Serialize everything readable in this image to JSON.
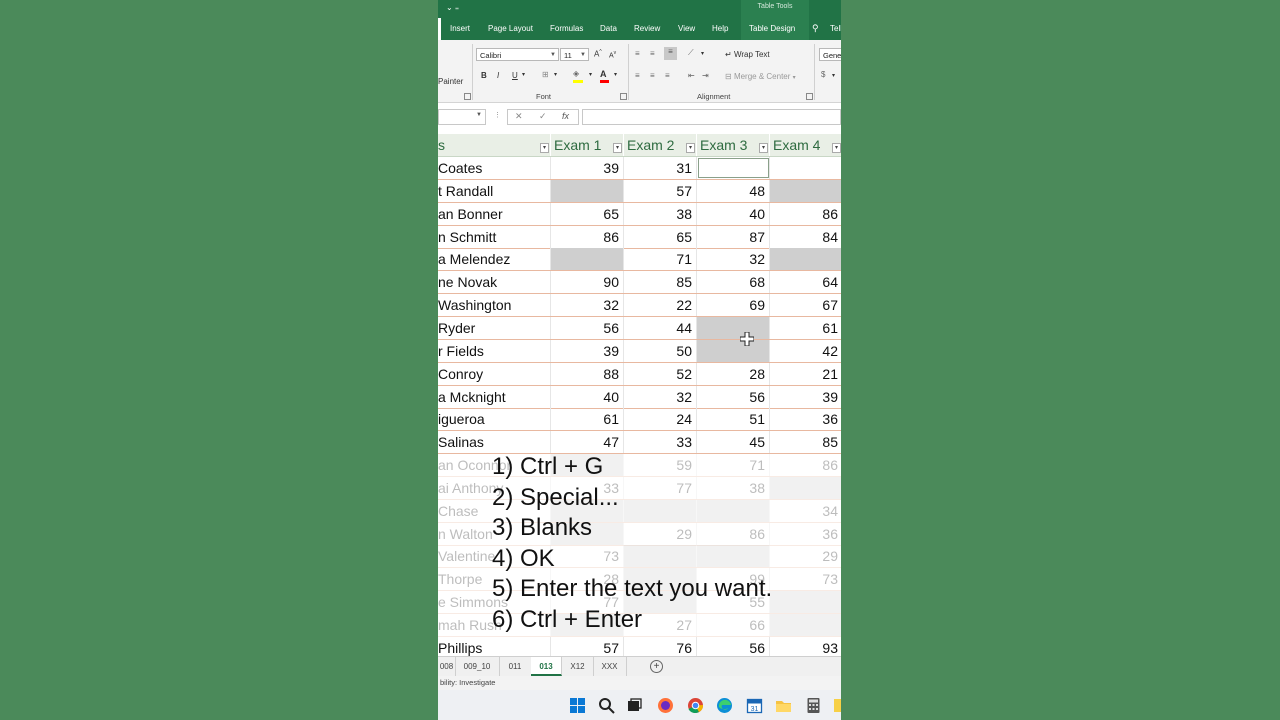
{
  "ribbon": {
    "context_title": "Table Tools",
    "tabs": [
      "Insert",
      "Page Layout",
      "Formulas",
      "Data",
      "Review",
      "View",
      "Help",
      "Table Design",
      "Tell"
    ],
    "painter_label": "Painter",
    "font_name": "Calibri",
    "font_size": "11",
    "font_group_label": "Font",
    "wrap_text_label": "Wrap Text",
    "merge_center_label": "Merge & Center",
    "alignment_group_label": "Alignment",
    "number_format": "Gene",
    "bold": "B",
    "italic": "I",
    "underline": "U"
  },
  "formula_bar": {
    "fx_label": "fx",
    "cancel": "✕",
    "enter": "✓"
  },
  "table": {
    "name_header": "s",
    "headers": [
      "Exam 1",
      "Exam 2",
      "Exam 3",
      "Exam 4"
    ],
    "rows": [
      {
        "name": "Coates",
        "values": [
          "39",
          "31",
          "",
          ""
        ],
        "blanks": [
          false,
          false,
          true,
          false
        ],
        "faded": false
      },
      {
        "name": "t Randall",
        "values": [
          "",
          "57",
          "48",
          ""
        ],
        "blanks": [
          true,
          false,
          false,
          true
        ],
        "faded": false
      },
      {
        "name": "an Bonner",
        "values": [
          "65",
          "38",
          "40",
          "86"
        ],
        "blanks": [
          false,
          false,
          false,
          false
        ],
        "faded": false
      },
      {
        "name": "n Schmitt",
        "values": [
          "86",
          "65",
          "87",
          "84"
        ],
        "blanks": [
          false,
          false,
          false,
          false
        ],
        "faded": false
      },
      {
        "name": "a Melendez",
        "values": [
          "",
          "71",
          "32",
          ""
        ],
        "blanks": [
          true,
          false,
          false,
          true
        ],
        "faded": false
      },
      {
        "name": "ne Novak",
        "values": [
          "90",
          "85",
          "68",
          "64"
        ],
        "blanks": [
          false,
          false,
          false,
          false
        ],
        "faded": false
      },
      {
        "name": " Washington",
        "values": [
          "32",
          "22",
          "69",
          "67"
        ],
        "blanks": [
          false,
          false,
          false,
          false
        ],
        "faded": false
      },
      {
        "name": " Ryder",
        "values": [
          "56",
          "44",
          "",
          "61"
        ],
        "blanks": [
          false,
          false,
          true,
          false
        ],
        "faded": false
      },
      {
        "name": "r Fields",
        "values": [
          "39",
          "50",
          "",
          "42"
        ],
        "blanks": [
          false,
          false,
          true,
          false
        ],
        "faded": false
      },
      {
        "name": "Conroy",
        "values": [
          "88",
          "52",
          "28",
          "21"
        ],
        "blanks": [
          false,
          false,
          false,
          false
        ],
        "faded": false
      },
      {
        "name": "a Mcknight",
        "values": [
          "40",
          "32",
          "56",
          "39"
        ],
        "blanks": [
          false,
          false,
          false,
          false
        ],
        "faded": false
      },
      {
        "name": "igueroa",
        "values": [
          "61",
          "24",
          "51",
          "36"
        ],
        "blanks": [
          false,
          false,
          false,
          false
        ],
        "faded": false
      },
      {
        "name": " Salinas",
        "values": [
          "47",
          "33",
          "45",
          "85"
        ],
        "blanks": [
          false,
          false,
          false,
          false
        ],
        "faded": false
      },
      {
        "name": "an Oconnor",
        "values": [
          "",
          "59",
          "71",
          "86"
        ],
        "blanks": [
          true,
          false,
          false,
          false
        ],
        "faded": true
      },
      {
        "name": "ai Anthony",
        "values": [
          "33",
          "77",
          "38",
          ""
        ],
        "blanks": [
          false,
          false,
          false,
          true
        ],
        "faded": true
      },
      {
        "name": "Chase",
        "values": [
          "",
          "",
          "",
          "34"
        ],
        "blanks": [
          true,
          true,
          true,
          false
        ],
        "faded": true
      },
      {
        "name": "n Walton",
        "values": [
          "",
          "29",
          "86",
          "36"
        ],
        "blanks": [
          true,
          false,
          false,
          false
        ],
        "faded": true
      },
      {
        "name": "Valentine",
        "values": [
          "73",
          "",
          "",
          "29"
        ],
        "blanks": [
          false,
          true,
          true,
          false
        ],
        "faded": true
      },
      {
        "name": "Thorpe",
        "values": [
          "28",
          "",
          "99",
          "73"
        ],
        "blanks": [
          false,
          true,
          false,
          false
        ],
        "faded": true
      },
      {
        "name": "e Simmons",
        "values": [
          "77",
          "",
          "55",
          ""
        ],
        "blanks": [
          false,
          true,
          false,
          true
        ],
        "faded": true
      },
      {
        "name": "mah Rush",
        "values": [
          "",
          "27",
          "66",
          ""
        ],
        "blanks": [
          true,
          false,
          false,
          true
        ],
        "faded": true
      },
      {
        "name": " Phillips",
        "values": [
          "57",
          "76",
          "56",
          "93"
        ],
        "blanks": [
          false,
          false,
          false,
          false
        ],
        "faded": false
      }
    ]
  },
  "steps": [
    "1) Ctrl + G",
    "2) Special...",
    "3) Blanks",
    "4) OK",
    "5) Enter the text you want.",
    "6) Ctrl + Enter"
  ],
  "sheet_tabs": [
    "008",
    "009_10",
    "011",
    "013",
    "X12",
    "XXX"
  ],
  "active_sheet": "013",
  "add_sheet_label": "+",
  "status_text": "bility: Investigate",
  "taskbar_icons": [
    "windows-start-icon",
    "search-icon",
    "task-view-icon",
    "firefox-icon",
    "chrome-icon",
    "edge-icon",
    "calendar-icon",
    "file-explorer-icon",
    "calculator-icon",
    "sticky-notes-icon"
  ],
  "colors": {
    "excel_green": "#217346",
    "background_green": "#4b8a5a",
    "blank_cell_gray": "#cfcfcf",
    "header_text": "#2e6b40"
  }
}
